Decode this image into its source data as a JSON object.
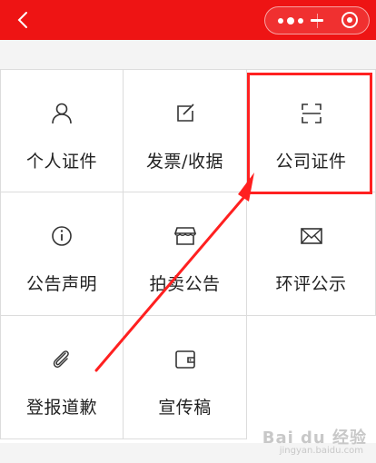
{
  "header": {
    "back_icon": "chevron-left-icon",
    "capsule": {
      "more_icon": "more-dots-icon",
      "minimize_icon": "minimize-icon",
      "close_icon": "target-close-icon"
    },
    "background_color": "#ee1414"
  },
  "grid": {
    "items": [
      {
        "label": "个人证件",
        "icon": "person-icon"
      },
      {
        "label": "发票/收据",
        "icon": "edit-icon"
      },
      {
        "label": "公司证件",
        "icon": "scan-icon"
      },
      {
        "label": "公告声明",
        "icon": "info-icon"
      },
      {
        "label": "拍卖公告",
        "icon": "store-icon"
      },
      {
        "label": "环评公示",
        "icon": "mail-icon"
      },
      {
        "label": "登报道歉",
        "icon": "paperclip-icon"
      },
      {
        "label": "宣传稿",
        "icon": "wallet-icon"
      }
    ]
  },
  "annotation": {
    "highlight_color": "#ff2020",
    "target": "公司证件"
  },
  "watermark": {
    "text": "Bai du 经验",
    "sub": "jingyan.baidu.com"
  }
}
